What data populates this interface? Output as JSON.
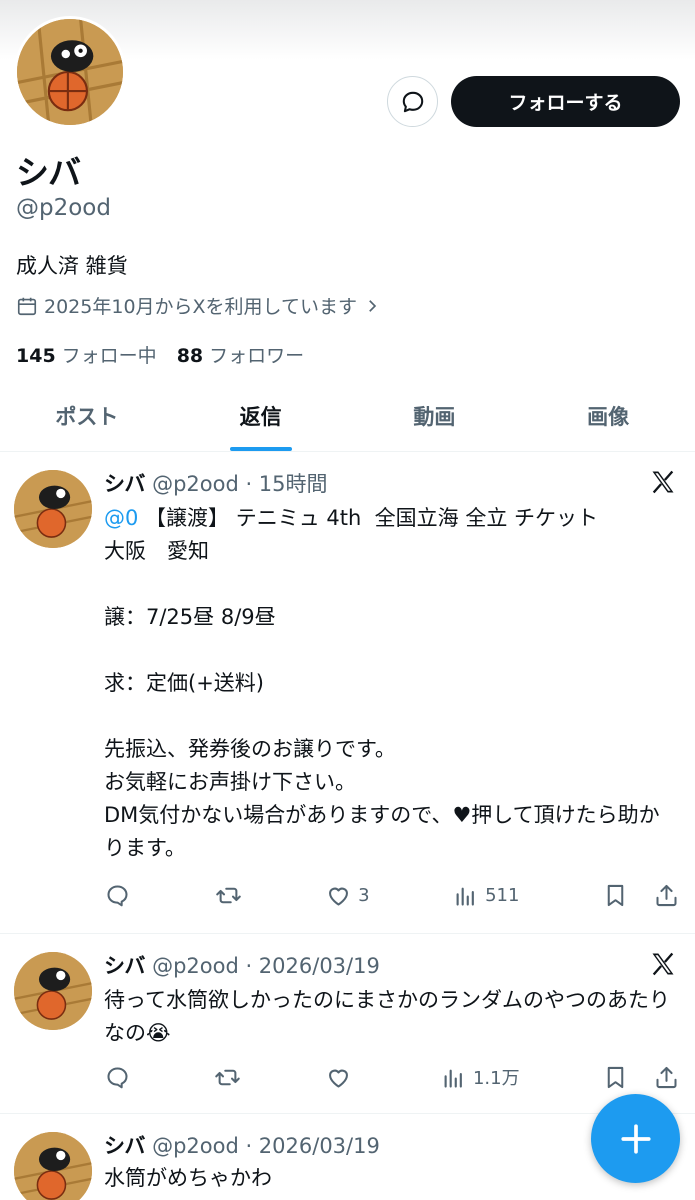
{
  "profile": {
    "display_name": "シバ",
    "handle": "@p2ood",
    "bio": "成人済 雑貨",
    "joined": "2025年10月からXを利用しています",
    "following_count": "145",
    "following_label": "フォロー中",
    "followers_count": "88",
    "followers_label": "フォロワー",
    "follow_button": "フォローする"
  },
  "tabs": [
    {
      "label": "ポスト",
      "active": false
    },
    {
      "label": "返信",
      "active": true
    },
    {
      "label": "動画",
      "active": false
    },
    {
      "label": "画像",
      "active": false
    }
  ],
  "tweets": [
    {
      "name": "シバ",
      "meta": "@p2ood · 15時間",
      "mention": "@0",
      "text": " 【譲渡】 テニミュ 4th  全国立海 全立 チケット\n大阪　愛知\n\n譲：7/25昼 8/9昼\n\n求：定価(+送料)\n\n先振込、発券後のお譲りです。\nお気軽にお声掛け下さい。\nDM気付かない場合がありますので、♥押して頂けたら助かります。",
      "likes": "3",
      "views": "511"
    },
    {
      "name": "シバ",
      "meta": "@p2ood · 2026/03/19",
      "text": "待って水筒欲しかったのにまさかのランダムのやつのあたりなの😭",
      "likes": "",
      "views": "1.1万"
    },
    {
      "name": "シバ",
      "meta": "@p2ood · 2026/03/19",
      "text": "水筒がめちゃかわ"
    }
  ],
  "colors": {
    "accent": "#1d9bf0",
    "text": "#0f1419",
    "muted": "#536471"
  },
  "icons": [
    "message-icon",
    "calendar-icon",
    "chevron-right-icon",
    "x-logo-icon",
    "reply-icon",
    "retweet-icon",
    "like-icon",
    "views-icon",
    "bookmark-icon",
    "share-icon",
    "plus-icon"
  ]
}
